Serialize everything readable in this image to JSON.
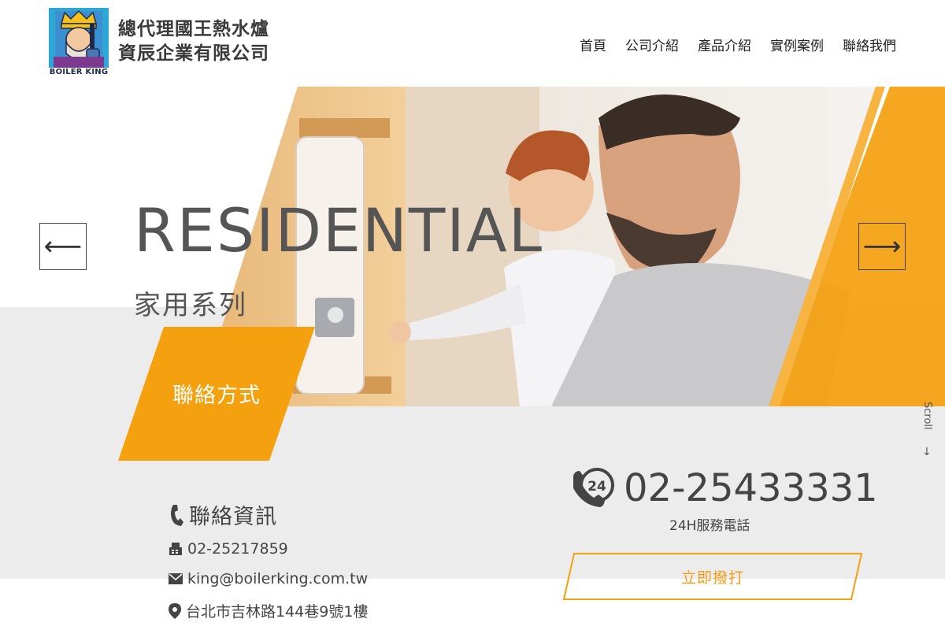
{
  "brand": {
    "company_line1": "總代理國王熱水爐",
    "company_line2": "資辰企業有限公司",
    "logo_caption": "BOILER KING"
  },
  "nav": {
    "items": [
      "首頁",
      "公司介紹",
      "產品介紹",
      "實例案例",
      "聯絡我們"
    ]
  },
  "hero": {
    "title": "RESIDENTIAL",
    "subtitle": "家用系列",
    "prev_icon": "arrow-left-icon",
    "next_icon": "arrow-right-icon",
    "prev_glyph": "⟵",
    "next_glyph": "⟶",
    "contact_tag": "聯絡方式",
    "scroll_label": "Scroll",
    "scroll_arrow": "↓"
  },
  "contact": {
    "heading": "聯絡資訊",
    "fax": "02-25217859",
    "email": "king@boilerking.com.tw",
    "address": "台北市吉林路144巷9號1樓",
    "phone_24h": "02-25433331",
    "phone_caption": "24H服務電話",
    "call_button": "立即撥打",
    "badge_24": "24"
  },
  "colors": {
    "accent_orange": "#f5a00f",
    "text_dark": "#444444",
    "band_gray": "#ececec",
    "navy": "#1e2a4a"
  }
}
